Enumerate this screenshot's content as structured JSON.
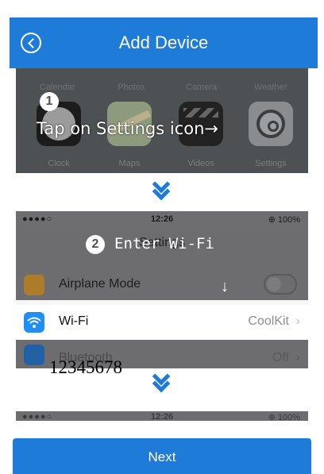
{
  "header": {
    "title": "Add Device",
    "back_icon": "back-circle-icon",
    "color": "#1e7bd8"
  },
  "step1": {
    "number": "1",
    "instruction": "Tap on Settings icon→",
    "top_row_labels": [
      "Calendar",
      "Photos",
      "Camera",
      "Weather"
    ],
    "apps": [
      {
        "name": "Clock",
        "icon": "clock-icon"
      },
      {
        "name": "Maps",
        "icon": "maps-icon"
      },
      {
        "name": "Videos",
        "icon": "videos-icon"
      },
      {
        "name": "Settings",
        "icon": "settings-gear-icon"
      }
    ]
  },
  "step2": {
    "number": "2",
    "instruction": "Enter Wi-Fi",
    "status_bar": {
      "signal": "●●●●○",
      "time": "12:26",
      "battery": "⊕ 100%"
    },
    "settings_title": "Settings",
    "airplane_label": "Airplane Mode",
    "wifi_label": "Wi-Fi",
    "wifi_value": "CoolKit",
    "bluetooth_label": "Bluetooth",
    "bluetooth_value": "Off",
    "arrow": "↓",
    "row_chevron": "›"
  },
  "overlay_code": "12345678",
  "step3": {
    "status_bar": {
      "signal": "●●●●○",
      "time": "12:26",
      "battery": "⊕ 100%"
    }
  },
  "next_label": "Next"
}
